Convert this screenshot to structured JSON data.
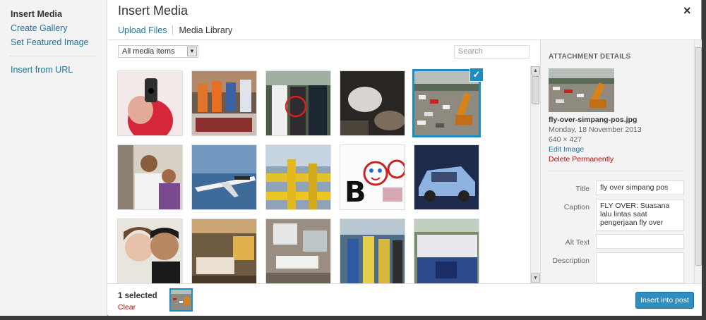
{
  "menu": {
    "items": [
      {
        "label": "Insert Media",
        "active": true
      },
      {
        "label": "Create Gallery"
      },
      {
        "label": "Set Featured Image"
      },
      {
        "label": "Insert from URL"
      }
    ]
  },
  "header": {
    "title": "Insert Media",
    "close": "×",
    "tabs": [
      {
        "label": "Upload Files"
      },
      {
        "label": "Media Library",
        "active": true
      }
    ]
  },
  "toolbar": {
    "filter_value": "All media items",
    "search_placeholder": "Search"
  },
  "grid": {
    "items": [
      {
        "desc": "pistol",
        "selected": false
      },
      {
        "desc": "press-conference",
        "selected": false
      },
      {
        "desc": "arrest",
        "selected": false
      },
      {
        "desc": "rubble",
        "selected": false
      },
      {
        "desc": "fly-over",
        "selected": true
      },
      {
        "desc": "family",
        "selected": false
      },
      {
        "desc": "airplane",
        "selected": false
      },
      {
        "desc": "pipes",
        "selected": false
      },
      {
        "desc": "boo-cartoon",
        "selected": false
      },
      {
        "desc": "car",
        "selected": false
      },
      {
        "desc": "couple",
        "selected": false
      },
      {
        "desc": "bedroom",
        "selected": false
      },
      {
        "desc": "bathroom",
        "selected": false
      },
      {
        "desc": "officials",
        "selected": false
      },
      {
        "desc": "team",
        "selected": false
      }
    ]
  },
  "details": {
    "heading": "Attachment Details",
    "filename": "fly-over-simpang-pos.jpg",
    "date": "Monday, 18 November 2013",
    "dimensions": "640 × 427",
    "edit_label": "Edit Image",
    "delete_label": "Delete Permanently",
    "title_label": "Title",
    "title_value": "fly over simpang pos",
    "caption_label": "Caption",
    "caption_value": "FLY OVER: Suasana lalu lintas saat pengerjaan fly over",
    "alt_label": "Alt Text",
    "alt_value": "",
    "description_label": "Description",
    "description_value": ""
  },
  "footer": {
    "selected_text": "1 selected",
    "clear_label": "Clear",
    "insert_label": "Insert into post"
  },
  "colors": {
    "accent": "#1e8cbe",
    "link": "#21759b",
    "danger": "#bc0b0b",
    "button": "#2e8ec2"
  }
}
